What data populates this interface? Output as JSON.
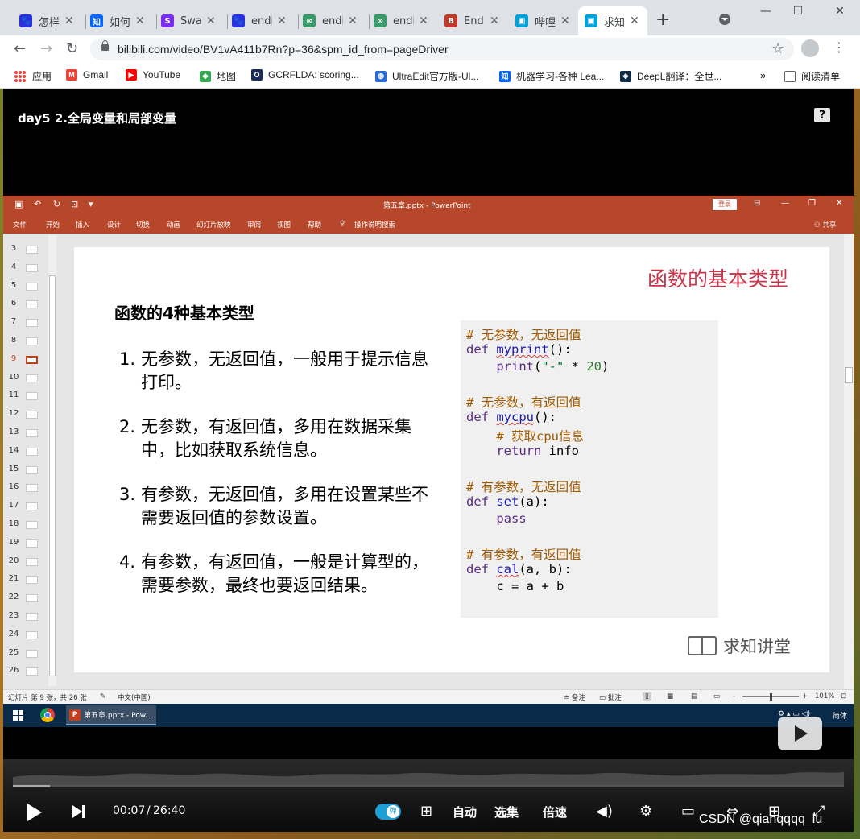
{
  "browser": {
    "tabs": [
      {
        "title": "怎样",
        "icon_color": "#2932e1",
        "icon_glyph": "🐾"
      },
      {
        "title": "如何",
        "icon_color": "#0066ff",
        "icon_glyph": "知"
      },
      {
        "title": "Swa",
        "icon_color": "#7b2cf5",
        "icon_glyph": "S"
      },
      {
        "title": "endi",
        "icon_color": "#2932e1",
        "icon_glyph": "🐾"
      },
      {
        "title": "endi",
        "icon_color": "#3a9a6a",
        "icon_glyph": "∞"
      },
      {
        "title": "endi",
        "icon_color": "#3a9a6a",
        "icon_glyph": "∞"
      },
      {
        "title": "End",
        "icon_color": "#c0392b",
        "icon_glyph": "B"
      },
      {
        "title": "哔哩",
        "icon_color": "#00a1d6",
        "icon_glyph": "▣"
      },
      {
        "title": "求知",
        "icon_color": "#00a1d6",
        "icon_glyph": "▣",
        "active": true
      }
    ],
    "new_tab": "+",
    "window_controls": [
      "—",
      "☐",
      "✕"
    ],
    "url": "bilibili.com/video/BV1vA411b7Rn?p=36&spm_id_from=pageDriver",
    "bookmarks": [
      {
        "label": "应用",
        "icon": "apps-icon"
      },
      {
        "label": "Gmail",
        "icon": "gmail-icon",
        "color": "#ea4335",
        "glyph": "M"
      },
      {
        "label": "YouTube",
        "icon": "youtube-icon",
        "color": "#ff0000",
        "glyph": "▶"
      },
      {
        "label": "地图",
        "icon": "maps-icon",
        "color": "#34a853",
        "glyph": "◆"
      },
      {
        "label": "GCRFLDA: scoring...",
        "icon": "gcrflda-icon",
        "color": "#1a2c5a",
        "glyph": "O"
      },
      {
        "label": "UltraEdit官方版-Ul...",
        "icon": "ultraedit-icon",
        "color": "#2a6ad6",
        "glyph": "◍"
      },
      {
        "label": "机器学习-各种 Lea...",
        "icon": "zhihu-icon",
        "color": "#0066ff",
        "glyph": "知"
      },
      {
        "label": "DeepL翻译：全世...",
        "icon": "deepl-icon",
        "color": "#0f2b46",
        "glyph": "◈"
      }
    ],
    "bookmarks_more": "»",
    "reading_list": "阅读清单"
  },
  "video": {
    "title": "day5 2.全局变量和局部变量",
    "current_time": "00:07",
    "time_separator": "/",
    "total_time": "26:40",
    "progress_fraction": 0.0044,
    "danmu_label": "弹",
    "auto_label": "自动",
    "episodes_label": "选集",
    "speed_label": "倍速"
  },
  "ppt": {
    "window_title": "第五章.pptx  -  PowerPoint",
    "login": "登录",
    "ribbon_tabs": [
      "文件",
      "开始",
      "插入",
      "设计",
      "切换",
      "动画",
      "幻灯片放映",
      "审阅",
      "视图",
      "帮助"
    ],
    "tell_me": "操作说明搜索",
    "share": "共享",
    "slide_numbers": [
      "3",
      "4",
      "5",
      "6",
      "7",
      "8",
      "9",
      "10",
      "11",
      "12",
      "13",
      "14",
      "15",
      "16",
      "17",
      "18",
      "19",
      "20",
      "21",
      "22",
      "23",
      "24",
      "25",
      "26"
    ],
    "selected_slide": "9",
    "status_slide": "幻灯片 第 9 张，共 26 张",
    "status_lang": "中文(中国)",
    "status_notes": "备注",
    "status_comments": "批注",
    "zoom": "101%"
  },
  "slide": {
    "title": "函数的基本类型",
    "heading": "函数的4种基本类型",
    "items": [
      {
        "num": "1.",
        "text": "无参数，无返回值，一般用于提示信息打印。"
      },
      {
        "num": "2.",
        "text": "无参数，有返回值，多用在数据采集中，比如获取系统信息。"
      },
      {
        "num": "3.",
        "text": "有参数，无返回值，多用在设置某些不需要返回值的参数设置。"
      },
      {
        "num": "4.",
        "text": "有参数，有返回值，一般是计算型的，需要参数，最终也要返回结果。"
      }
    ],
    "code": {
      "c1": "# 无参数，无返回值",
      "c2": "# 无参数，有返回值",
      "c3": "# 获取cpu信息",
      "c4": "# 有参数，无返回值",
      "c5": "# 有参数，有返回值",
      "def": "def",
      "return": "return",
      "pass": "pass",
      "print": "print",
      "f1": "myprint",
      "f2": "mycpu",
      "f3": "set",
      "f4": "cal",
      "paren_empty": "():",
      "p3": "(a):",
      "p4": "(a, b):",
      "print_args_open": "(",
      "print_str": "\"-\"",
      "print_op": " * ",
      "print_num": "20",
      "print_close": ")",
      "ret_val": " info",
      "calc": "c = a + b"
    },
    "brand": "求知讲堂"
  },
  "taskbar": {
    "ppt_label": "第五章.pptx - Pow...",
    "ime": "简体"
  },
  "watermark": "CSDN @qianqqqq_lu"
}
